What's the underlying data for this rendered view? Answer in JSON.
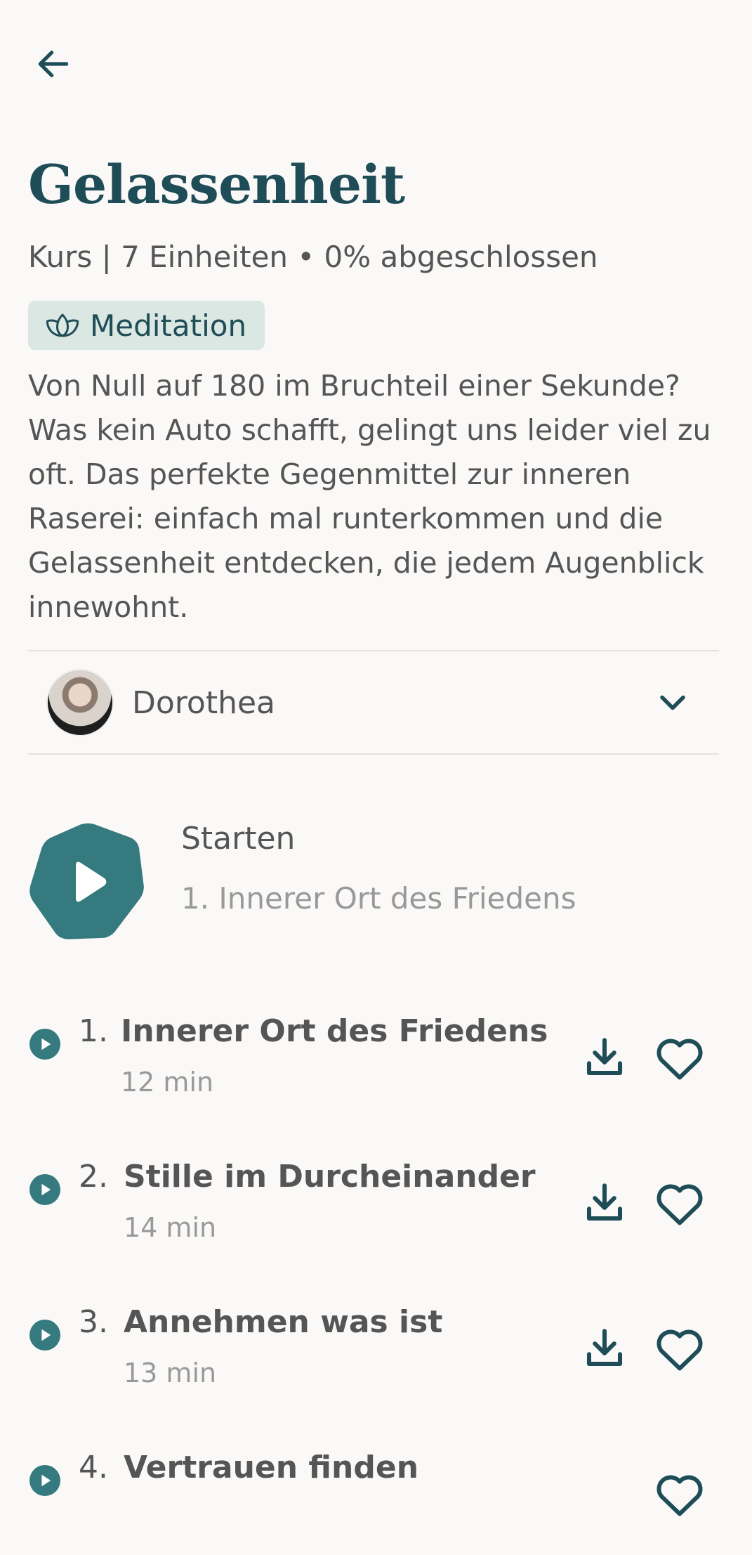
{
  "course": {
    "title": "Gelassenheit",
    "meta": "Kurs | 7 Einheiten • 0% abgeschlossen",
    "tag": "Meditation",
    "description": "Von Null auf 180 im Bruchteil einer Sekunde? Was kein Auto schafft, gelingt uns leider viel zu oft. Das perfekte Gegenmittel zur inneren Raserei: einfach mal runterkommen und die Gelassenheit entdecken, die jedem Augenblick innewohnt.",
    "progress_percent": 0
  },
  "teacher": {
    "name": "Dorothea"
  },
  "start": {
    "label": "Starten",
    "next": "1. Innerer Ort des Friedens"
  },
  "tracks": [
    {
      "num": "1.",
      "title": "Innerer Ort des Friedens",
      "duration": "12 min"
    },
    {
      "num": "2.",
      "title": "Stille im Durcheinander",
      "duration": "14 min"
    },
    {
      "num": "3.",
      "title": "Annehmen was ist",
      "duration": "13 min"
    },
    {
      "num": "4.",
      "title": "Vertrauen finden",
      "duration": ""
    }
  ],
  "colors": {
    "accent": "#357a7e",
    "title": "#1f4d57",
    "tag_bg": "#dbe7e2",
    "background": "#faf9f8"
  },
  "icons": {
    "back": "arrow-left-icon",
    "tag": "lotus-icon",
    "expand": "chevron-down-icon",
    "play": "play-icon",
    "download": "download-icon",
    "favorite": "heart-icon"
  }
}
